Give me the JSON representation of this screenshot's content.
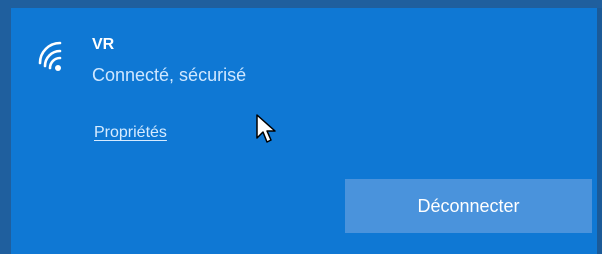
{
  "network": {
    "name": "VR",
    "status": "Connecté, sécurisé",
    "icon": "wifi-icon"
  },
  "links": {
    "properties_label": "Propriétés"
  },
  "actions": {
    "disconnect_label": "Déconnecter"
  },
  "colors": {
    "panel_background": "#0f78d4",
    "button_background": "#4a93dc",
    "text_primary": "#ffffff"
  }
}
